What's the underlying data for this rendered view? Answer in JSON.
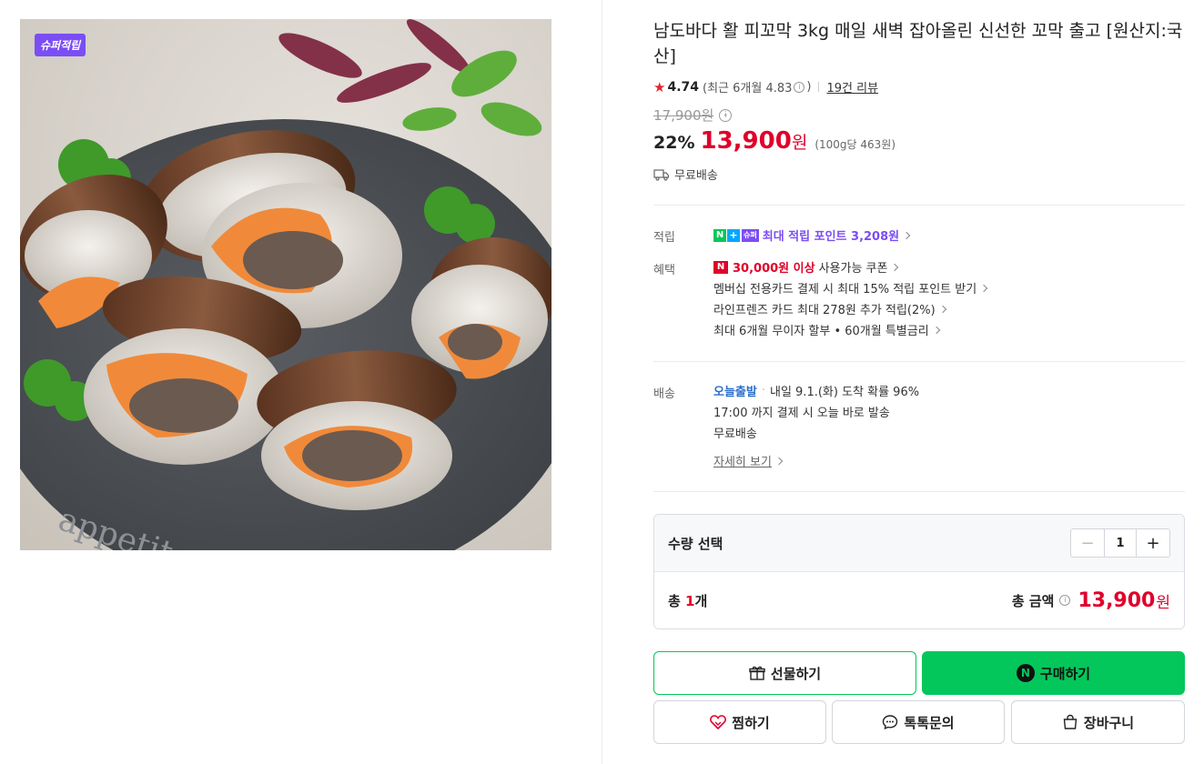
{
  "product": {
    "badge": "슈퍼적립",
    "image_watermark": "appetito",
    "title": "남도바다 활 피꼬막 3kg 매일 새벽 잡아올린 신선한 꼬막 출고 [원산지:국산]",
    "rating": "4.74",
    "rating_recent": "(최근 6개월 4.83",
    "rating_recent_close": ")",
    "review_link": "19건 리뷰",
    "original_price": "17,900원",
    "discount": "22%",
    "sale_price": "13,900",
    "won": "원",
    "unit_price": "(100g당 463원)",
    "shipping_badge": "무료배송"
  },
  "points": {
    "label": "적립",
    "super_mark": "슈퍼",
    "text": "최대 적립 포인트 3,208원"
  },
  "benefits": {
    "label": "혜택",
    "coupon_highlight": "30,000원 이상",
    "coupon_rest": "사용가능 쿠폰",
    "membership": "멤버십 전용카드 결제 시 최대 15% 적립 포인트 받기",
    "line_friends": "라인프렌즈 카드 최대 278원 추가 적립(2%)",
    "installment": "최대 6개월 무이자 할부 • 60개월 특별금리"
  },
  "delivery": {
    "label": "배송",
    "today": "오늘출발",
    "arrival": "내일 9.1.(화) 도착 확률 96%",
    "cutoff": "17:00 까지 결제 시 오늘 바로 발송",
    "fee": "무료배송",
    "detail_link": "자세히 보기"
  },
  "quantity": {
    "label": "수량 선택",
    "value": "1",
    "minus": "−",
    "plus": "+",
    "total_prefix": "총 ",
    "total_count": "1",
    "total_suffix": "개",
    "total_label": "총 금액",
    "total_price": "13,900",
    "total_won": "원"
  },
  "actions": {
    "gift": "선물하기",
    "buy": "구매하기",
    "wish": "찜하기",
    "talk": "톡톡문의",
    "cart": "장바구니"
  },
  "colors": {
    "accent_green": "#03c75a",
    "price_red": "#e0002a",
    "super_purple": "#7b4df5",
    "today_blue": "#2d6ec9"
  },
  "icons": [
    "star-icon",
    "info-icon",
    "truck-icon",
    "chevron-right-icon",
    "gift-icon",
    "naver-n-icon",
    "heart-icon",
    "chat-icon",
    "shopping-bag-icon"
  ]
}
